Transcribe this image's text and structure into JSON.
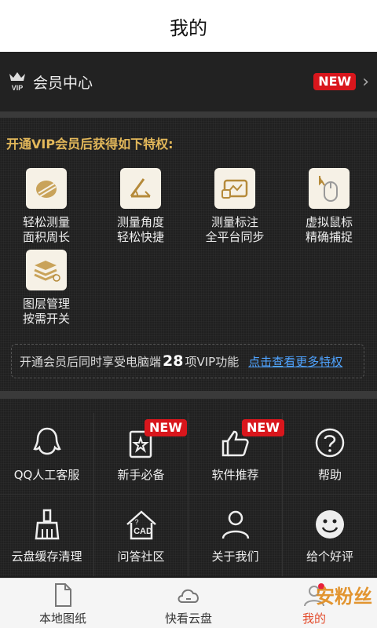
{
  "header": {
    "title": "我的"
  },
  "vip": {
    "title": "会员中心",
    "badge": "NEW"
  },
  "privileges": {
    "title": "开通VIP会员后获得如下特权:",
    "features": [
      {
        "label": "轻松测量\n面积周长",
        "icon": "measure-area-icon"
      },
      {
        "label": "测量角度\n轻松快捷",
        "icon": "angle-icon"
      },
      {
        "label": "测量标注\n全平台同步",
        "icon": "sync-annotation-icon"
      },
      {
        "label": "虚拟鼠标\n精确捕捉",
        "icon": "mouse-icon"
      },
      {
        "label": "图层管理\n按需开关",
        "icon": "layers-icon"
      }
    ],
    "more_prefix": "开通会员后同时享受电脑端",
    "more_count": "28",
    "more_suffix": "项VIP功能",
    "more_link": "点击查看更多特权"
  },
  "grid": [
    {
      "label": "QQ人工客服",
      "icon": "qq-icon"
    },
    {
      "label": "新手必备",
      "icon": "starred-book-icon",
      "badge": "NEW"
    },
    {
      "label": "软件推荐",
      "icon": "thumbs-up-icon",
      "badge": "NEW"
    },
    {
      "label": "帮助",
      "icon": "help-icon"
    },
    {
      "label": "云盘缓存清理",
      "icon": "broom-icon"
    },
    {
      "label": "问答社区",
      "icon": "cad-house-icon"
    },
    {
      "label": "关于我们",
      "icon": "person-icon"
    },
    {
      "label": "给个好评",
      "icon": "smiley-icon"
    }
  ],
  "tabs": [
    {
      "label": "本地图纸",
      "icon": "file-icon"
    },
    {
      "label": "快看云盘",
      "icon": "cloud-icon"
    },
    {
      "label": "我的",
      "icon": "user-icon"
    }
  ],
  "watermark": "安粉丝",
  "colors": {
    "accent_gold": "#e3b85a",
    "badge_red": "#d9161c",
    "link_blue": "#4fa3ff"
  }
}
